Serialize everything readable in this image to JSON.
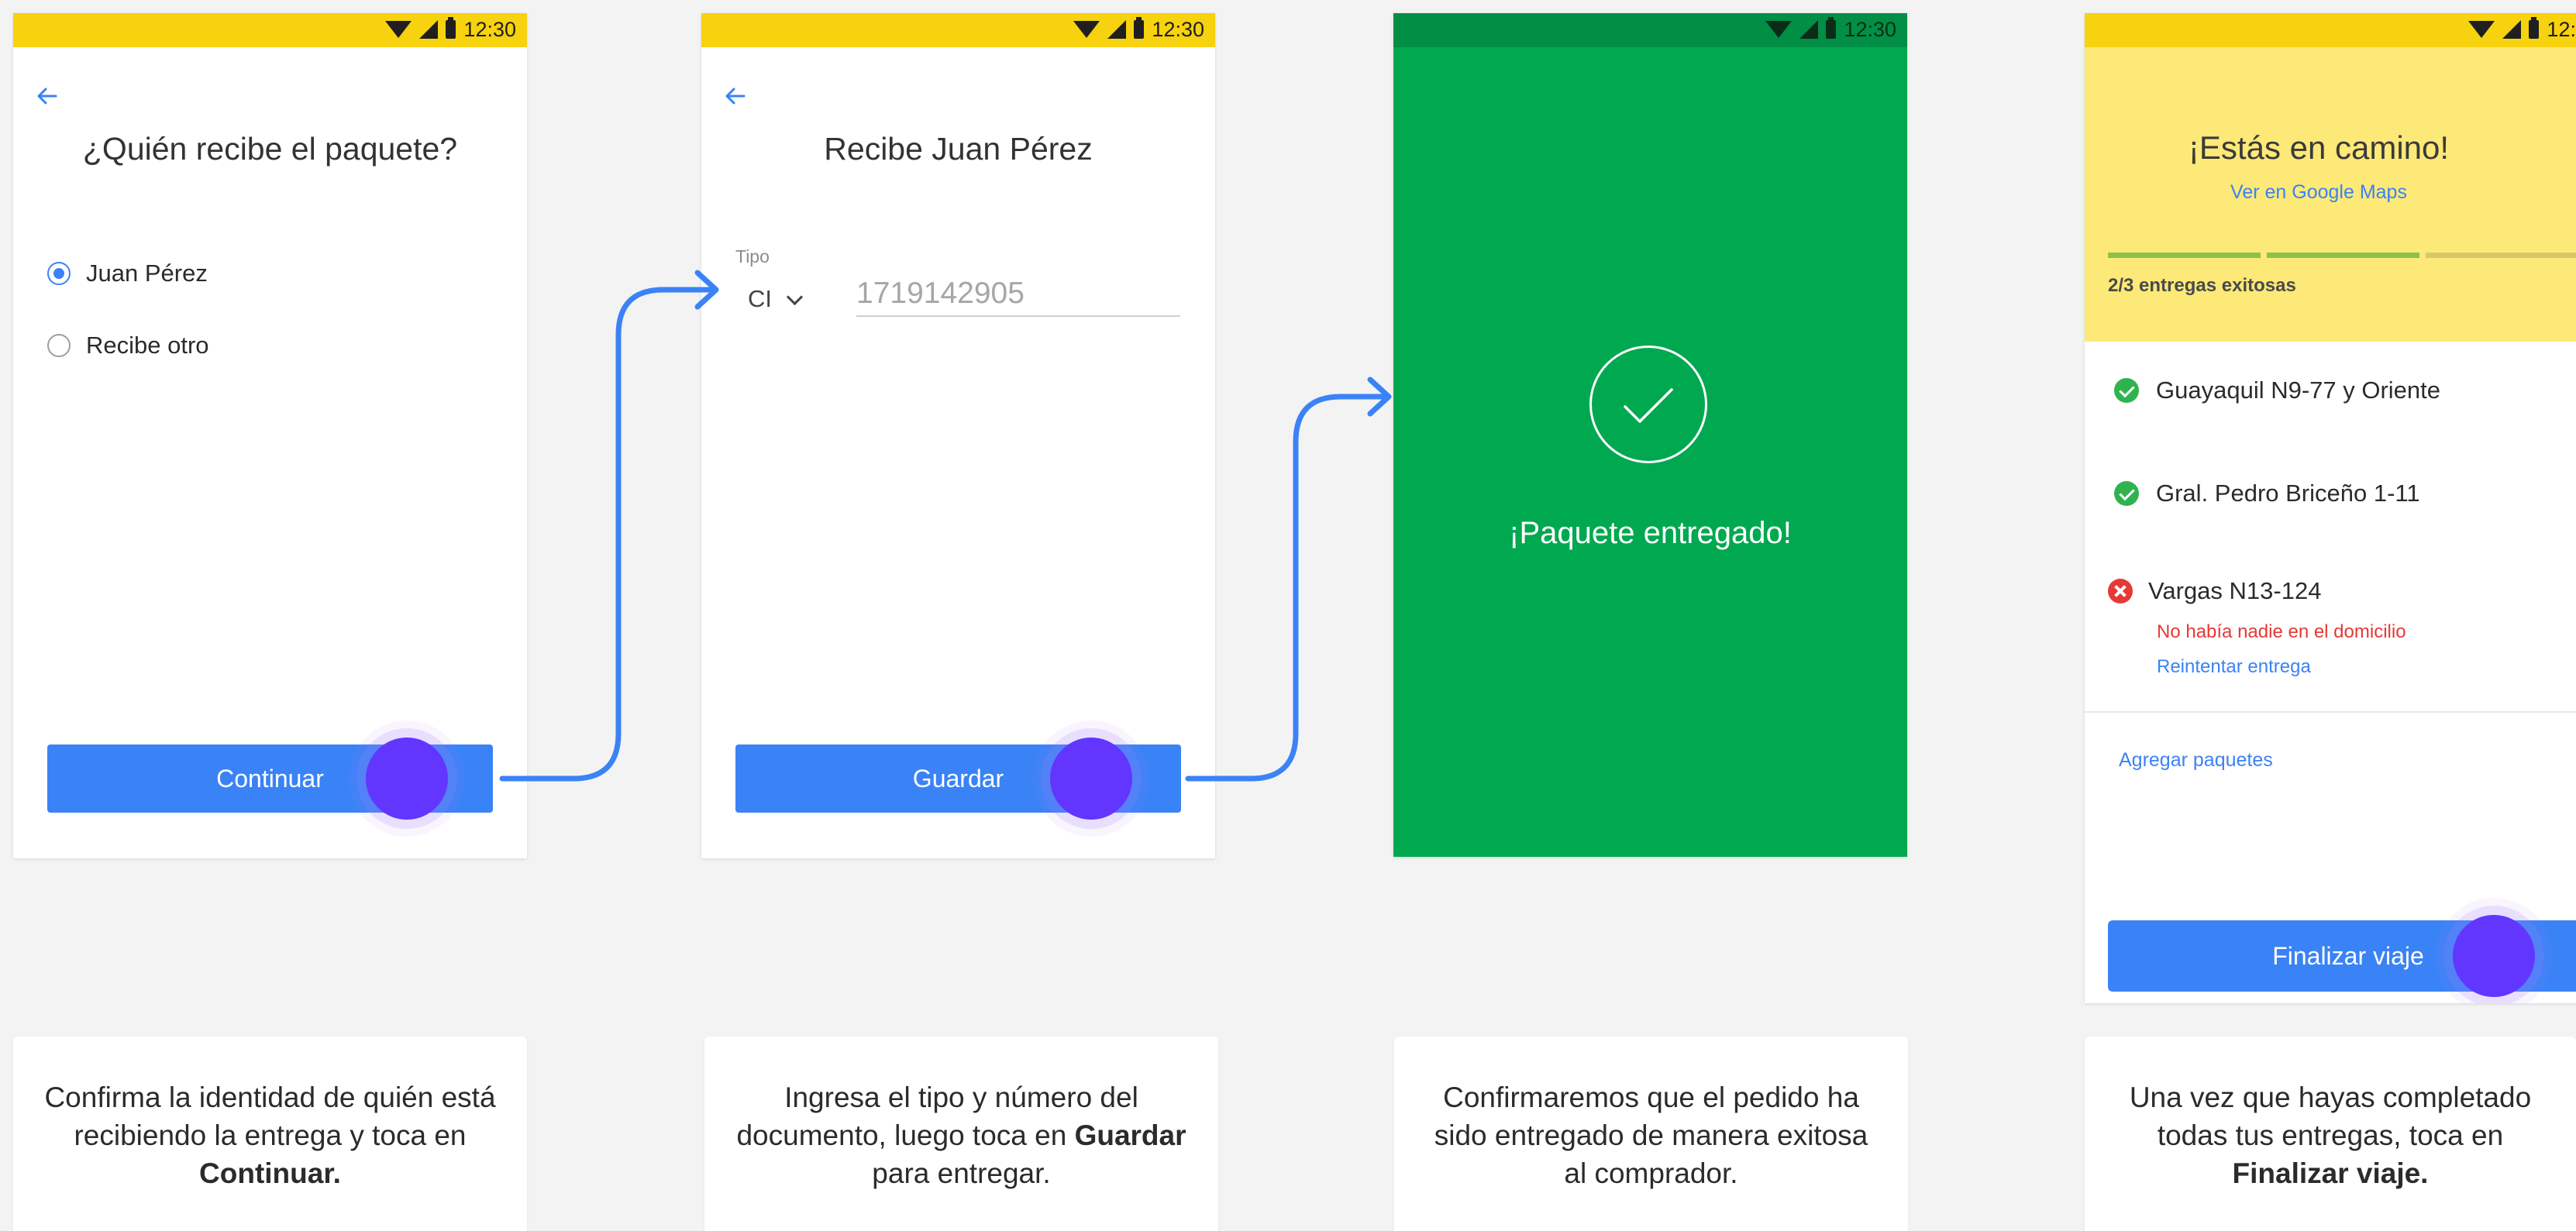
{
  "status_bar": {
    "time": "12:30"
  },
  "screen1": {
    "title": "¿Quién recibe el paquete?",
    "options": [
      {
        "label": "Juan Pérez",
        "selected": true
      },
      {
        "label": "Recibe otro",
        "selected": false
      }
    ],
    "button": "Continuar"
  },
  "screen2": {
    "title": "Recibe Juan Pérez",
    "type_label": "Tipo",
    "type_value": "CI",
    "doc_number": "1719142905",
    "button": "Guardar"
  },
  "screen3": {
    "message": "¡Paquete entregado!"
  },
  "screen4": {
    "title": "¡Estás en camino!",
    "maps_link": "Ver en Google Maps",
    "progress_text": "2/3 entregas exitosas",
    "progress": {
      "done": 2,
      "total": 3
    },
    "stops": [
      {
        "address": "Guayaquil N9-77 y Oriente",
        "status": "success"
      },
      {
        "address": "Gral. Pedro Briceño 1-11",
        "status": "success"
      },
      {
        "address": "Vargas N13-124",
        "status": "failed",
        "error": "No había nadie en el domicilio",
        "action": "Reintentar entrega"
      }
    ],
    "add_link": "Agregar paquetes",
    "button": "Finalizar viaje"
  },
  "captions": [
    {
      "before": "Confirma la identidad de quién está recibiendo la entrega y toca en ",
      "bold": "Continuar.",
      "after": ""
    },
    {
      "before": "Ingresa el tipo y número del documento, luego toca en ",
      "bold": "Guardar",
      "after": " para entregar."
    },
    {
      "before": "Confirmaremos que el pedido ha sido entregado de manera exitosa al comprador.",
      "bold": "",
      "after": ""
    },
    {
      "before": "Una vez que hayas completado todas tus entregas, toca en ",
      "bold": "Finalizar viaje.",
      "after": ""
    }
  ],
  "colors": {
    "primary": "#3a83f6",
    "status_yellow": "#f6d20f",
    "success_green": "#00a84f",
    "touch_purple": "#6236ff",
    "header_yellow": "#fde977",
    "error_red": "#e53935"
  }
}
